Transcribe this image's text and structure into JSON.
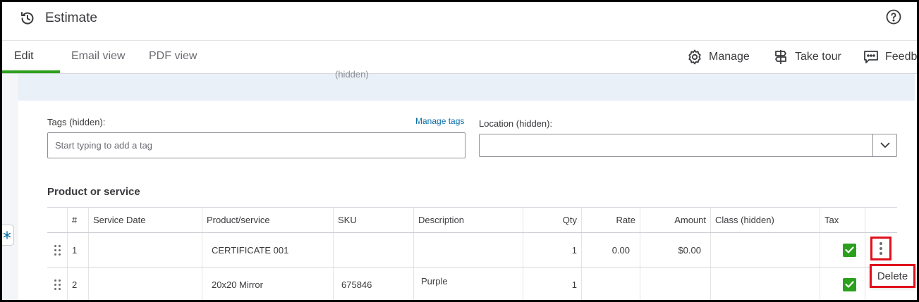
{
  "header": {
    "title": "Estimate",
    "icons": [
      "history-icon",
      "help-icon"
    ]
  },
  "tabs": [
    {
      "label": "Edit",
      "active": true
    },
    {
      "label": "Email view",
      "active": false
    },
    {
      "label": "PDF view",
      "active": false
    }
  ],
  "toolbar": {
    "manage_label": "Manage",
    "tour_label": "Take tour",
    "feedback_label": "Feedb"
  },
  "band": {
    "hidden_fragment": "(hidden)"
  },
  "form": {
    "tags_label": "Tags (hidden):",
    "manage_tags_label": "Manage tags",
    "tags_placeholder": "Start typing to add a tag",
    "location_label": "Location (hidden):",
    "location_value": ""
  },
  "products": {
    "section_title": "Product or service",
    "columns": [
      "#",
      "Service Date",
      "Product/service",
      "SKU",
      "Description",
      "Qty",
      "Rate",
      "Amount",
      "Class (hidden)",
      "Tax"
    ],
    "rows": [
      {
        "num": "1",
        "service_date": "",
        "product": "CERTIFICATE 001",
        "sku": "",
        "description": "",
        "qty": "1",
        "rate": "0.00",
        "amount": "$0.00",
        "class": "",
        "tax": true
      },
      {
        "num": "2",
        "service_date": "",
        "product": "20x20 Mirror",
        "sku": "675846",
        "description": "Purple",
        "qty": "1",
        "rate": "",
        "amount": "",
        "class": "",
        "tax": true
      }
    ],
    "row_menu": {
      "delete_label": "Delete"
    }
  },
  "colors": {
    "accent": "#2ca01c",
    "highlight": "#e0101c",
    "link": "#0d6fa8"
  }
}
